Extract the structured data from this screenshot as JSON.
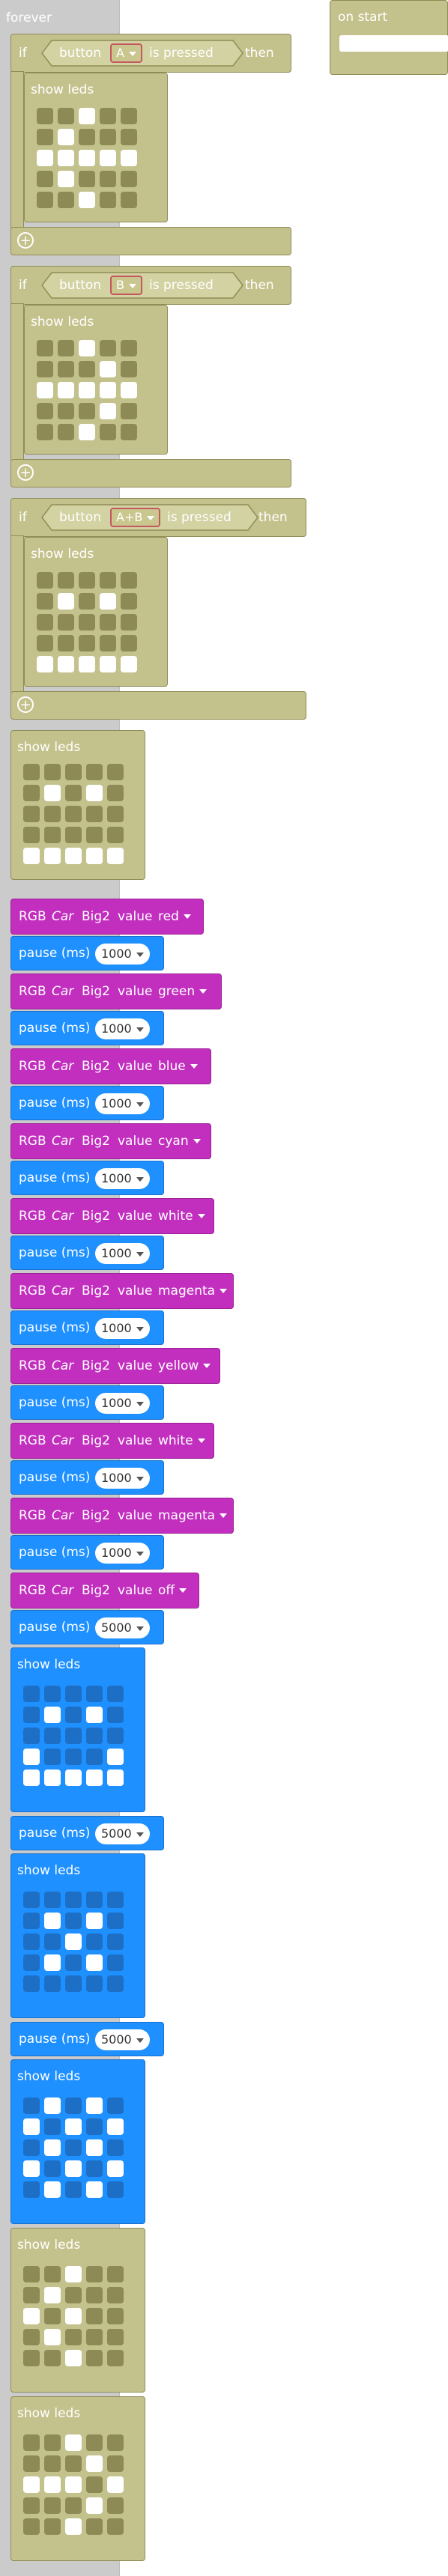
{
  "forever": {
    "label": "forever"
  },
  "on_start": {
    "label": "on start"
  },
  "if_blocks": [
    {
      "if_label": "if",
      "button_label": "button",
      "button_value": "A",
      "pressed_label": "is pressed",
      "then_label": "then",
      "body_label": "show leds",
      "leds": [
        [
          0,
          0,
          1,
          0,
          0
        ],
        [
          0,
          1,
          0,
          0,
          0
        ],
        [
          1,
          1,
          1,
          1,
          1
        ],
        [
          0,
          1,
          0,
          0,
          0
        ],
        [
          0,
          0,
          1,
          0,
          0
        ]
      ]
    },
    {
      "if_label": "if",
      "button_label": "button",
      "button_value": "B",
      "pressed_label": "is pressed",
      "then_label": "then",
      "body_label": "show leds",
      "leds": [
        [
          0,
          0,
          1,
          0,
          0
        ],
        [
          0,
          0,
          0,
          1,
          0
        ],
        [
          1,
          1,
          1,
          1,
          1
        ],
        [
          0,
          0,
          0,
          1,
          0
        ],
        [
          0,
          0,
          1,
          0,
          0
        ]
      ]
    },
    {
      "if_label": "if",
      "button_label": "button",
      "button_value": "A+B",
      "pressed_label": "is pressed",
      "then_label": "then",
      "body_label": "show leds",
      "leds": [
        [
          0,
          0,
          0,
          0,
          0
        ],
        [
          0,
          1,
          0,
          1,
          0
        ],
        [
          0,
          0,
          0,
          0,
          0
        ],
        [
          0,
          0,
          0,
          0,
          0
        ],
        [
          1,
          1,
          1,
          1,
          1
        ]
      ]
    }
  ],
  "plus_symbol": "+",
  "show_leds_1": {
    "label": "show leds",
    "leds": [
      [
        0,
        0,
        0,
        0,
        0
      ],
      [
        0,
        1,
        0,
        1,
        0
      ],
      [
        0,
        0,
        0,
        0,
        0
      ],
      [
        0,
        0,
        0,
        0,
        0
      ],
      [
        1,
        1,
        1,
        1,
        1
      ]
    ]
  },
  "rgb_rows": [
    {
      "rgb": "RGB",
      "car": "Car",
      "big": "Big2",
      "value_label": "value",
      "color": "red",
      "pause_label": "pause (ms)",
      "pause": "1000"
    },
    {
      "rgb": "RGB",
      "car": "Car",
      "big": "Big2",
      "value_label": "value",
      "color": "green",
      "pause_label": "pause (ms)",
      "pause": "1000"
    },
    {
      "rgb": "RGB",
      "car": "Car",
      "big": "Big2",
      "value_label": "value",
      "color": "blue",
      "pause_label": "pause (ms)",
      "pause": "1000"
    },
    {
      "rgb": "RGB",
      "car": "Car",
      "big": "Big2",
      "value_label": "value",
      "color": "cyan",
      "pause_label": "pause (ms)",
      "pause": "1000"
    },
    {
      "rgb": "RGB",
      "car": "Car",
      "big": "Big2",
      "value_label": "value",
      "color": "white",
      "pause_label": "pause (ms)",
      "pause": "1000"
    },
    {
      "rgb": "RGB",
      "car": "Car",
      "big": "Big2",
      "value_label": "value",
      "color": "magenta",
      "pause_label": "pause (ms)",
      "pause": "1000"
    },
    {
      "rgb": "RGB",
      "car": "Car",
      "big": "Big2",
      "value_label": "value",
      "color": "yellow",
      "pause_label": "pause (ms)",
      "pause": "1000"
    },
    {
      "rgb": "RGB",
      "car": "Car",
      "big": "Big2",
      "value_label": "value",
      "color": "white",
      "pause_label": "pause (ms)",
      "pause": "1000"
    },
    {
      "rgb": "RGB",
      "car": "Car",
      "big": "Big2",
      "value_label": "value",
      "color": "magenta",
      "pause_label": "pause (ms)",
      "pause": "1000"
    },
    {
      "rgb": "RGB",
      "car": "Car",
      "big": "Big2",
      "value_label": "value",
      "color": "off",
      "pause_label": "pause (ms)",
      "pause": "5000"
    }
  ],
  "blue_leds_1": {
    "label": "show leds",
    "leds": [
      [
        0,
        0,
        0,
        0,
        0
      ],
      [
        0,
        1,
        0,
        1,
        0
      ],
      [
        0,
        0,
        0,
        0,
        0
      ],
      [
        1,
        0,
        0,
        0,
        1
      ],
      [
        1,
        1,
        1,
        1,
        1
      ]
    ]
  },
  "pause_after_blue_1": {
    "label": "pause (ms)",
    "value": "5000"
  },
  "blue_leds_2": {
    "label": "show leds",
    "leds": [
      [
        0,
        0,
        0,
        0,
        0
      ],
      [
        0,
        1,
        0,
        1,
        0
      ],
      [
        0,
        0,
        1,
        0,
        0
      ],
      [
        0,
        1,
        0,
        1,
        0
      ],
      [
        0,
        0,
        0,
        0,
        0
      ]
    ]
  },
  "pause_after_blue_2": {
    "label": "pause (ms)",
    "value": "5000"
  },
  "blue_leds_3": {
    "label": "show leds",
    "leds": [
      [
        0,
        1,
        0,
        1,
        0
      ],
      [
        1,
        0,
        1,
        0,
        1
      ],
      [
        0,
        1,
        0,
        1,
        0
      ],
      [
        1,
        0,
        1,
        0,
        1
      ],
      [
        0,
        1,
        0,
        1,
        0
      ]
    ]
  },
  "olive_leds_2": {
    "label": "show leds",
    "leds": [
      [
        0,
        0,
        1,
        0,
        0
      ],
      [
        0,
        1,
        0,
        0,
        0
      ],
      [
        1,
        0,
        1,
        0,
        0
      ],
      [
        0,
        1,
        0,
        0,
        0
      ],
      [
        0,
        0,
        1,
        0,
        0
      ]
    ]
  },
  "olive_leds_3": {
    "label": "show leds",
    "leds": [
      [
        0,
        0,
        1,
        0,
        0
      ],
      [
        0,
        0,
        0,
        1,
        0
      ],
      [
        1,
        1,
        1,
        0,
        1
      ],
      [
        0,
        0,
        0,
        1,
        0
      ],
      [
        0,
        0,
        1,
        0,
        0
      ]
    ]
  },
  "colors": {
    "olive": "#c4c28c",
    "magenta": "#c22fbf",
    "blue": "#1e90ff",
    "rail": "#cbcbcb"
  }
}
